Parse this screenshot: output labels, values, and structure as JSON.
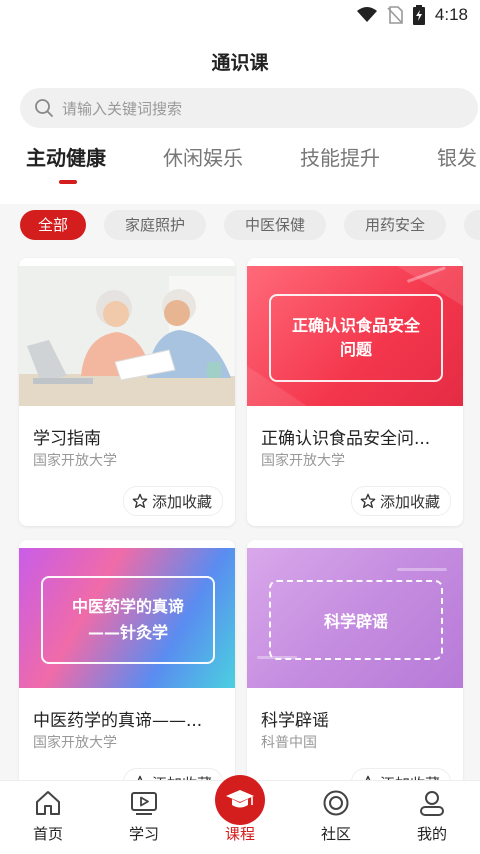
{
  "status_bar": {
    "time": "4:18",
    "icons": [
      "wifi-icon",
      "no-sim-icon",
      "battery-charging-icon"
    ]
  },
  "header": {
    "title": "通识课"
  },
  "search": {
    "placeholder": "请输入关键词搜索"
  },
  "tabs": [
    {
      "label": "主动健康",
      "active": true
    },
    {
      "label": "休闲娱乐"
    },
    {
      "label": "技能提升"
    },
    {
      "label": "银发"
    }
  ],
  "chips": [
    {
      "label": "全部",
      "active": true
    },
    {
      "label": "家庭照护"
    },
    {
      "label": "中医保健"
    },
    {
      "label": "用药安全"
    }
  ],
  "courses": [
    {
      "title": "学习指南",
      "provider": "国家开放大学",
      "fav_label": "添加收藏",
      "thumb_text": ""
    },
    {
      "title": "正确认识食品安全问...",
      "provider": "国家开放大学",
      "fav_label": "添加收藏",
      "thumb_text": "正确认识食品安全\n问题"
    },
    {
      "title": "中医药学的真谛——...",
      "provider": "国家开放大学",
      "fav_label": "添加收藏",
      "thumb_text": "中医药学的真谛\n——针灸学"
    },
    {
      "title": "科学辟谣",
      "provider": "科普中国",
      "fav_label": "添加收藏",
      "thumb_text": "科学辟谣"
    }
  ],
  "bottom_nav": [
    {
      "label": "首页",
      "icon": "home-icon"
    },
    {
      "label": "学习",
      "icon": "video-icon"
    },
    {
      "label": "课程",
      "icon": "graduation-cap-icon",
      "active": true
    },
    {
      "label": "社区",
      "icon": "community-icon"
    },
    {
      "label": "我的",
      "icon": "profile-icon"
    }
  ],
  "colors": {
    "accent": "#d41e1e"
  }
}
